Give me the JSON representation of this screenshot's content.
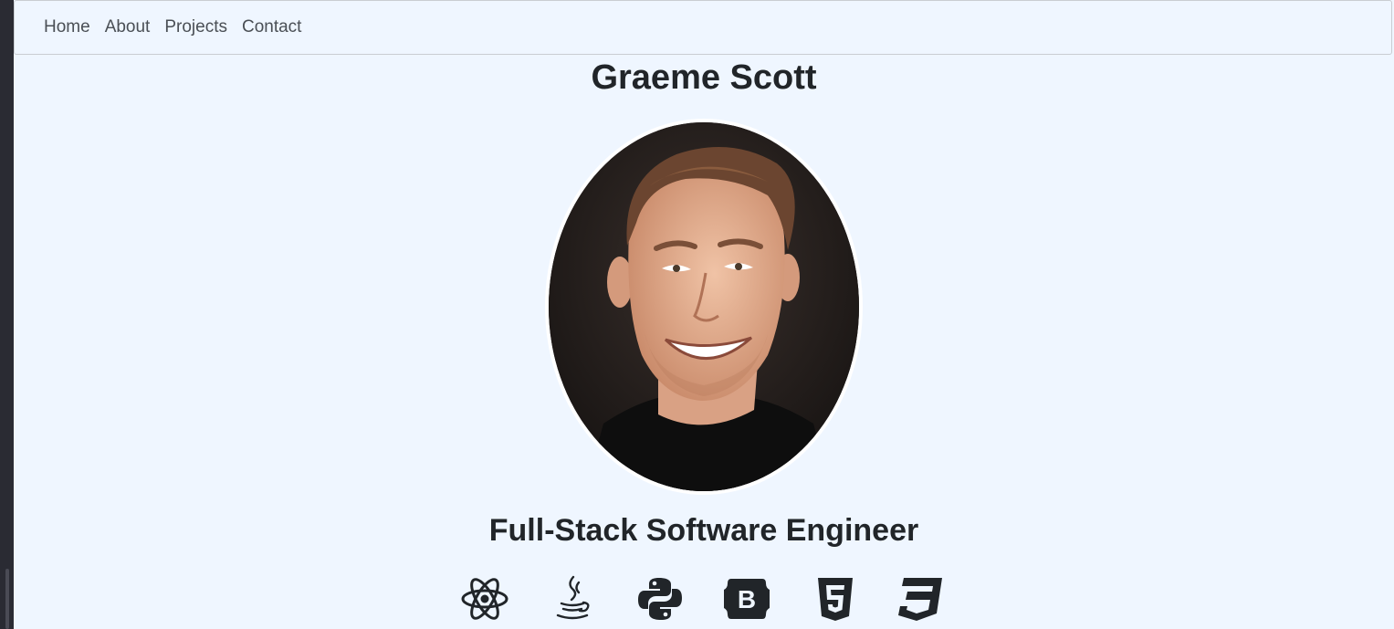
{
  "nav": {
    "items": [
      {
        "label": "Home"
      },
      {
        "label": "About"
      },
      {
        "label": "Projects"
      },
      {
        "label": "Contact"
      }
    ]
  },
  "profile": {
    "name": "Graeme Scott",
    "role": "Full-Stack Software Engineer",
    "photo": "portrait-photo"
  },
  "skills": {
    "icons": [
      "react-icon",
      "java-icon",
      "python-icon",
      "bootstrap-icon",
      "html5-icon",
      "css3-icon"
    ]
  },
  "colors": {
    "page_background": "#eff6ff",
    "text": "#212529",
    "icon": "#212529"
  }
}
